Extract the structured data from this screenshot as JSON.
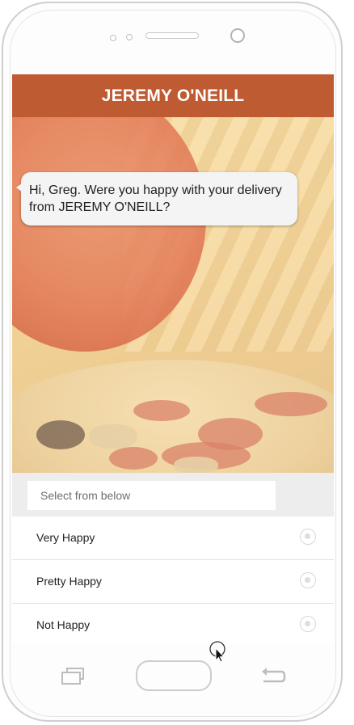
{
  "app": {
    "title": "JEREMY O'NEILL"
  },
  "chat": {
    "message": "Hi, Greg. Were you happy with your delivery from JEREMY O'NEILL?"
  },
  "select": {
    "placeholder": "Select from below"
  },
  "options": [
    {
      "label": "Very Happy"
    },
    {
      "label": "Pretty Happy"
    },
    {
      "label": "Not Happy"
    }
  ],
  "colors": {
    "header": "#bf5b33",
    "bubble": "#f4f4f4"
  },
  "icons": {
    "recent": "recent-apps-icon",
    "home": "home-button",
    "back": "back-arrow-icon",
    "cursor": "mouse-cursor-icon"
  }
}
